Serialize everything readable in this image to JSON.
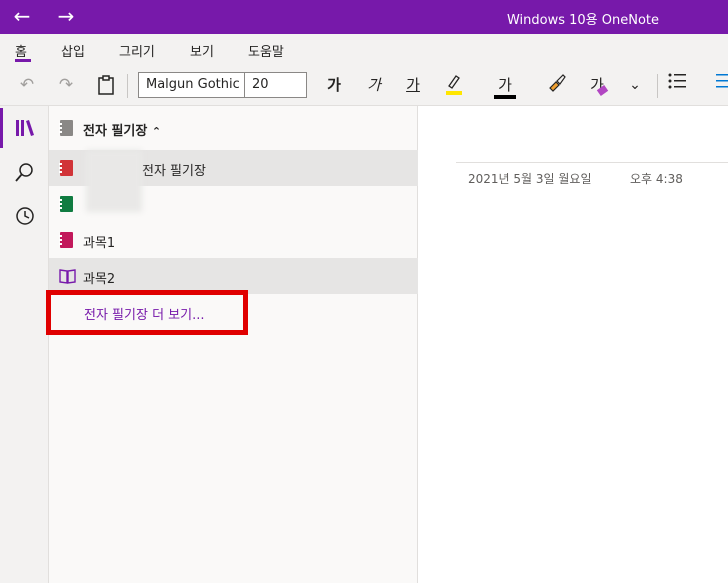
{
  "window": {
    "title": "Windows 10용 OneNote",
    "accent_color": "#7719aa"
  },
  "menu": {
    "items": [
      "홈",
      "삽입",
      "그리기",
      "보기",
      "도움말"
    ],
    "active_index": 0
  },
  "toolbar": {
    "font_name": "Malgun Gothic",
    "font_size": "20",
    "bold_label": "가",
    "italic_label": "가",
    "underline_label": "가",
    "font_color_label": "가",
    "format_painter_label": "가"
  },
  "notebooks": {
    "header": "전자 필기장",
    "items": [
      {
        "label": "전자 필기장",
        "icon": "notebook-red-icon",
        "color": "#d13438",
        "selected": true
      },
      {
        "label": "",
        "icon": "notebook-green-icon",
        "color": "#107c41",
        "selected": false
      },
      {
        "label": "과목1",
        "icon": "notebook-pink-icon",
        "color": "#c2185b",
        "selected": false
      },
      {
        "label": "과목2",
        "icon": "notebook-open-icon",
        "color": "#7719aa",
        "selected": true
      }
    ],
    "more_link": "전자 필기장 더 보기..."
  },
  "page": {
    "date": "2021년 5월 3일 월요일",
    "time": "오후 4:38"
  }
}
